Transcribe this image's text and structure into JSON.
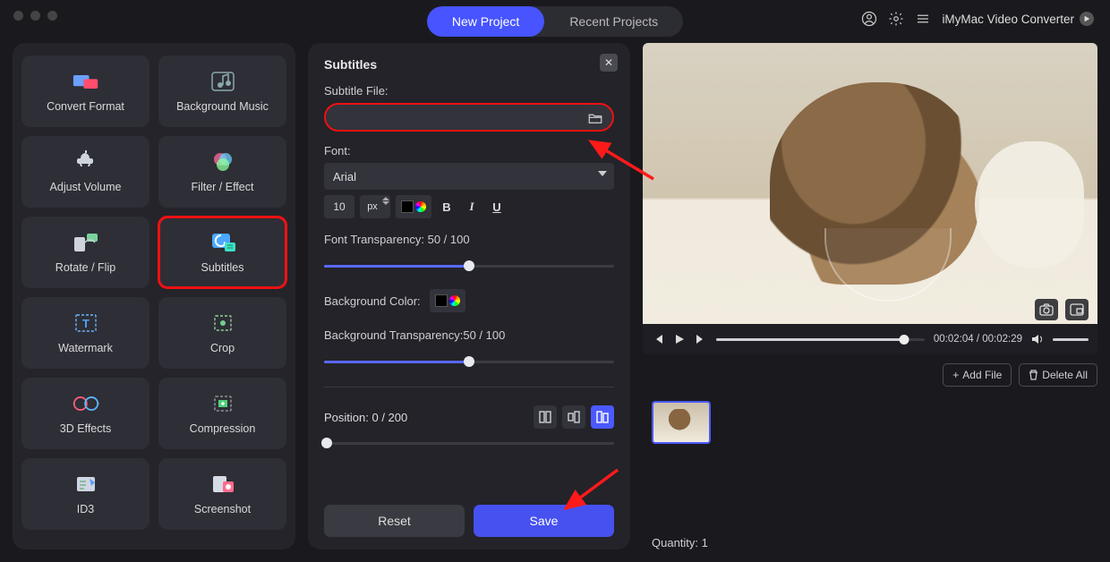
{
  "topbar": {
    "new_project": "New Project",
    "recent_projects": "Recent Projects",
    "brand": "iMyMac Video Converter"
  },
  "tools": [
    {
      "id": "convert-format",
      "label": "Convert Format"
    },
    {
      "id": "background-music",
      "label": "Background Music"
    },
    {
      "id": "adjust-volume",
      "label": "Adjust Volume"
    },
    {
      "id": "filter-effect",
      "label": "Filter / Effect"
    },
    {
      "id": "rotate-flip",
      "label": "Rotate / Flip"
    },
    {
      "id": "subtitles",
      "label": "Subtitles",
      "selected": true
    },
    {
      "id": "watermark",
      "label": "Watermark"
    },
    {
      "id": "crop",
      "label": "Crop"
    },
    {
      "id": "3d-effects",
      "label": "3D Effects"
    },
    {
      "id": "compression",
      "label": "Compression"
    },
    {
      "id": "id3",
      "label": "ID3"
    },
    {
      "id": "screenshot",
      "label": "Screenshot"
    }
  ],
  "panel": {
    "title": "Subtitles",
    "subtitle_file_label": "Subtitle File:",
    "subtitle_file_value": "",
    "font_label": "Font:",
    "font_value": "Arial",
    "font_size": "10",
    "font_unit": "px",
    "bold": "B",
    "italic": "I",
    "underline": "U",
    "font_transparency_label": "Font Transparency: 50 / 100",
    "font_transparency_pct": 50,
    "bg_color_label": "Background Color:",
    "bg_transparency_label": "Background Transparency:50 / 100",
    "bg_transparency_pct": 50,
    "position_label": "Position: 0 / 200",
    "position_pct": 0,
    "reset": "Reset",
    "save": "Save"
  },
  "player": {
    "time_current": "00:02:04",
    "time_total": "00:02:29",
    "progress_pct": 90
  },
  "files": {
    "add_file": "Add File",
    "delete_all": "Delete All",
    "quantity_label": "Quantity: 1"
  }
}
